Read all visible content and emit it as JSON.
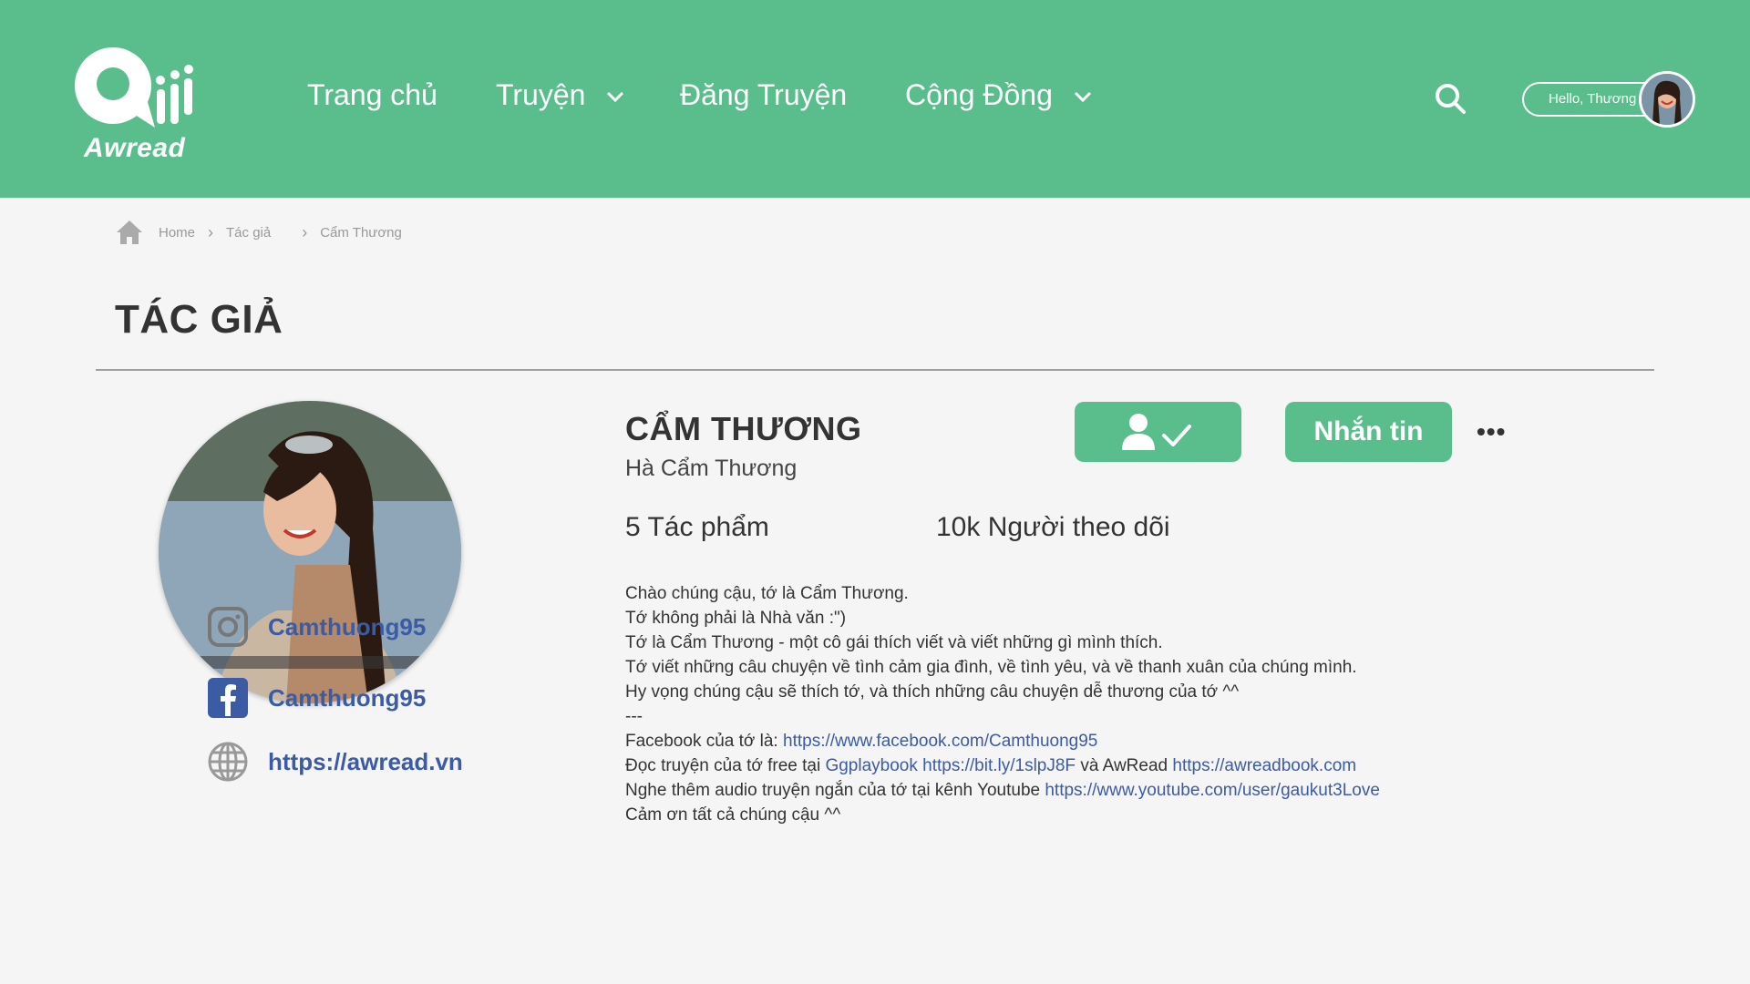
{
  "brand": {
    "logo_text": "Awread",
    "color": "#5abe8c"
  },
  "nav": {
    "items": [
      {
        "label": "Trang chủ",
        "has_dropdown": false
      },
      {
        "label": "Truyện",
        "has_dropdown": true
      },
      {
        "label": "Đăng Truyện",
        "has_dropdown": false
      },
      {
        "label": "Cộng Đồng",
        "has_dropdown": true
      }
    ],
    "greeting": "Hello, Thương",
    "search_icon": "search-icon"
  },
  "breadcrumb": {
    "items": [
      "Home",
      "Tác giả",
      "Cẩm Thương"
    ]
  },
  "page_title": "TÁC GIẢ",
  "author": {
    "display_name": "CẨM THƯƠNG",
    "full_name": "Hà Cẩm Thương",
    "works": "5 Tác phẩm",
    "followers": "10k Người theo dõi",
    "message_label": "Nhắn tin",
    "more_label": "•••",
    "socials": [
      {
        "icon": "instagram-icon",
        "label": "Camthuong95"
      },
      {
        "icon": "facebook-icon",
        "label": "Camthuong95"
      },
      {
        "icon": "globe-icon",
        "label": "https://awread.vn"
      }
    ]
  },
  "bio": {
    "lines": [
      "Chào chúng cậu, tớ là Cẩm Thương.",
      "Tớ không phải là Nhà văn :\")",
      "Tớ là Cẩm Thương - một cô gái thích viết và viết những gì mình thích.",
      "Tớ viết những câu chuyện về tình cảm gia đình, về tình yêu, và về thanh xuân của chúng mình.",
      "Hy vọng chúng cậu sẽ thích tớ, và thích những câu chuyện dễ thương của tớ ^^",
      "---"
    ],
    "facebook_prefix": "Facebook của tớ là: ",
    "facebook_url": "https://www.facebook.com/Camthuong95",
    "read_prefix": "Đọc truyện của tớ free tại ",
    "ggplay_label": "Ggplaybook https://bit.ly/1slpJ8F",
    "read_middle": " và AwRead ",
    "awread_url": "https://awreadbook.com",
    "audio_prefix": "Nghe thêm audio truyện ngắn của tớ tại kênh Youtube ",
    "youtube_url": "https://www.youtube.com/user/gaukut3Love",
    "closing": "Cảm ơn tất cả chúng cậu ^^"
  }
}
